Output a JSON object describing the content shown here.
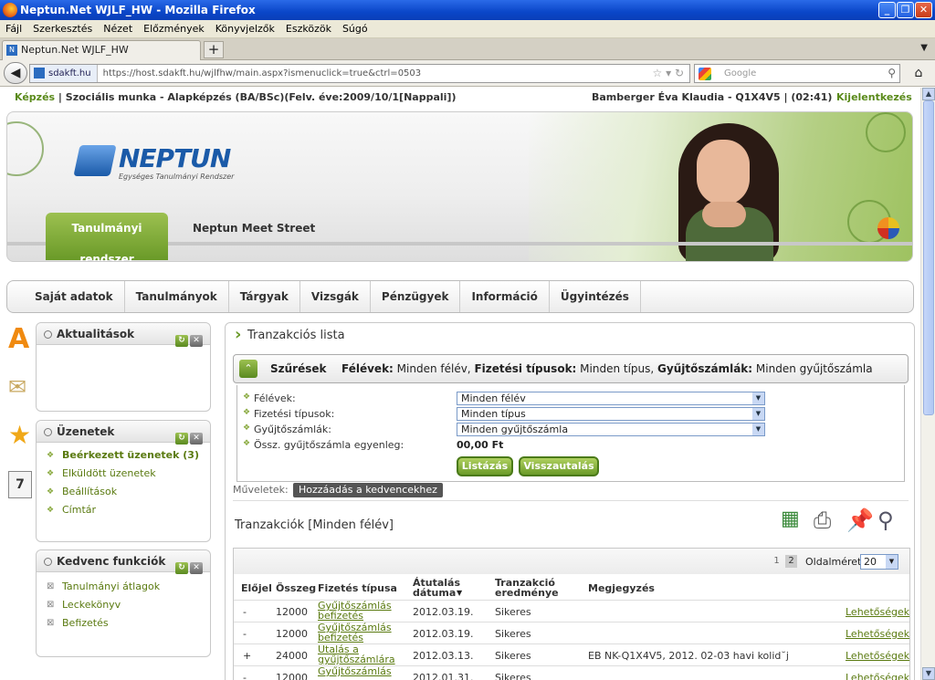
{
  "window": {
    "title": "Neptun.Net WJLF_HW - Mozilla Firefox",
    "min": "_",
    "max": "❐",
    "close": "✕"
  },
  "menu": [
    "Fájl",
    "Szerkesztés",
    "Nézet",
    "Előzmények",
    "Könyvjelzők",
    "Eszközök",
    "Súgó"
  ],
  "tab": {
    "label": "Neptun.Net WJLF_HW",
    "new": "+"
  },
  "nav": {
    "site": "sdakft.hu",
    "url": "https://host.sdakft.hu/wjlfhw/main.aspx?ismenuclick=true&ctrl=0503",
    "search_placeholder": "Google"
  },
  "info": {
    "left_green": "Képzés",
    "left": "| Szociális munka - Alapképzés (BA/BSc)(Felv. éve:2009/10/1[Nappali])",
    "user": "Bamberger Éva Klaudia - Q1X4V5  |  (02:41)",
    "logout": "Kijelentkezés"
  },
  "banner": {
    "logo": "NEPTUN",
    "logo_sub": "Egységes Tanulmányi Rendszer",
    "tab_active": "Tanulmányi rendszer",
    "tab_other": "Neptun Meet Street"
  },
  "mainmenu": [
    "Saját adatok",
    "Tanulmányok",
    "Tárgyak",
    "Vizsgák",
    "Pénzügyek",
    "Információ",
    "Ügyintézés"
  ],
  "side": {
    "news_title": "Aktualitások",
    "msg_title": "Üzenetek",
    "msg_items": [
      "Beérkezett üzenetek (3)",
      "Elküldött üzenetek",
      "Beállítások",
      "Címtár"
    ],
    "fav_title": "Kedvenc funkciók",
    "fav_items": [
      "Tanulmányi átlagok",
      "Leckekönyv",
      "Befizetés"
    ]
  },
  "main": {
    "title": "Tranzakciós lista",
    "filter_label": "Szűrések",
    "filter_summary_1": "Félévek:",
    "filter_summary_1v": "Minden félév,",
    "filter_summary_2": "Fizetési típusok:",
    "filter_summary_2v": "Minden típus,",
    "filter_summary_3": "Gyűjtőszámlák:",
    "filter_summary_3v": "Minden gyűjtőszámla",
    "f1_label": "Félévek:",
    "f1_value": "Minden félév",
    "f2_label": "Fizetési típusok:",
    "f2_value": "Minden típus",
    "f3_label": "Gyűjtőszámlák:",
    "f3_value": "Minden gyűjtőszámla",
    "f4_label": "Össz. gyűjtőszámla egyenleg:",
    "f4_value": "00,00 Ft",
    "btn_list": "Listázás",
    "btn_refund": "Visszautalás",
    "ops_label": "Műveletek:",
    "add_fav": "Hozzáadás a kedvencekhez",
    "table_title": "Tranzakciók [Minden félév]",
    "page1": "1",
    "page2": "2",
    "page_size_label": "Oldalméret",
    "page_size": "20",
    "headers": {
      "sign": "Előjel",
      "amount": "Összeg",
      "type": "Fizetés típusa",
      "date": "Átutalás dátuma",
      "result": "Tranzakció eredménye",
      "note": "Megjegyzés"
    },
    "rows": [
      {
        "sign": "-",
        "amount": "12000",
        "type1": "Gyűjtőszámlás",
        "type2": "befizetés",
        "date": "2012.03.19.",
        "result": "Sikeres",
        "note": "",
        "opt": "Lehetőségek"
      },
      {
        "sign": "-",
        "amount": "12000",
        "type1": "Gyűjtőszámlás",
        "type2": "befizetés",
        "date": "2012.03.19.",
        "result": "Sikeres",
        "note": "",
        "opt": "Lehetőségek"
      },
      {
        "sign": "+",
        "amount": "24000",
        "type1": "Utalás a",
        "type2": "gyűjtőszámlára",
        "date": "2012.03.13.",
        "result": "Sikeres",
        "note": "EB NK-Q1X4V5, 2012. 02-03 havi kolid˘j",
        "opt": "Lehetőségek"
      },
      {
        "sign": "-",
        "amount": "12000",
        "type1": "Gyűjtőszámlás",
        "type2": "",
        "date": "2012.01.31.",
        "result": "Sikeres",
        "note": "",
        "opt": "Lehetőségek"
      }
    ]
  }
}
